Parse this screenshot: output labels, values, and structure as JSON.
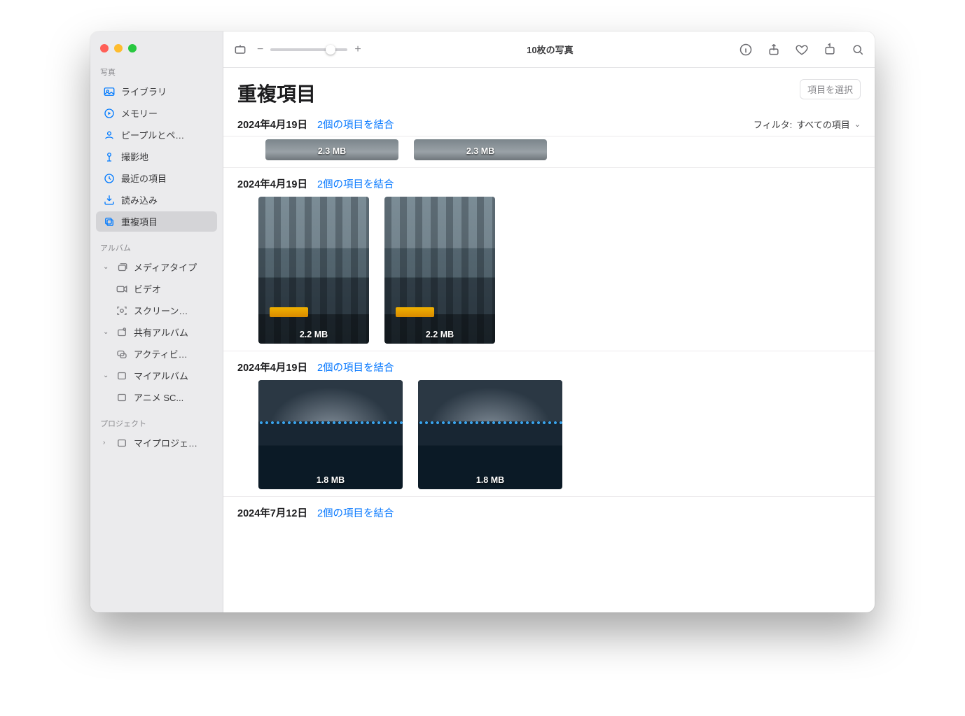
{
  "toolbar": {
    "title": "10枚の写真"
  },
  "sidebar": {
    "sections": [
      {
        "label": "写真"
      },
      {
        "label": "アルバム"
      },
      {
        "label": "プロジェクト"
      }
    ],
    "items_photos": [
      {
        "label": "ライブラリ"
      },
      {
        "label": "メモリー"
      },
      {
        "label": "ピープルとペ…"
      },
      {
        "label": "撮影地"
      },
      {
        "label": "最近の項目"
      },
      {
        "label": "読み込み"
      },
      {
        "label": "重複項目"
      }
    ],
    "albums": {
      "media_types": {
        "label": "メディアタイプ",
        "children": [
          {
            "label": "ビデオ"
          },
          {
            "label": "スクリーン…"
          }
        ]
      },
      "shared": {
        "label": "共有アルバム",
        "children": [
          {
            "label": "アクティビ…"
          }
        ]
      },
      "my": {
        "label": "マイアルバム",
        "children": [
          {
            "label": "アニメ SC..."
          }
        ]
      }
    },
    "projects": {
      "label": "マイプロジェ…"
    }
  },
  "header": {
    "title": "重複項目",
    "select_button": "項目を選択"
  },
  "sticky": {
    "date": "2024年4月19日",
    "merge": "2個の項目を結合",
    "filter_label": "フィルタ:",
    "filter_value": "すべての項目"
  },
  "groups": [
    {
      "date": "2024年4月19日",
      "merge": "2個の項目を結合",
      "cut_top": true,
      "thumb_w": 190,
      "thumb_h": 30,
      "img_class": "img-road",
      "thumbs": [
        {
          "size": "2.3 MB"
        },
        {
          "size": "2.3 MB"
        }
      ]
    },
    {
      "date": "2024年4月19日",
      "merge": "2個の項目を結合",
      "thumb_w": 158,
      "thumb_h": 210,
      "img_class": "img-city",
      "thumbs": [
        {
          "size": "2.2 MB"
        },
        {
          "size": "2.2 MB"
        }
      ]
    },
    {
      "date": "2024年4月19日",
      "merge": "2個の項目を結合",
      "thumb_w": 206,
      "thumb_h": 156,
      "img_class": "img-night",
      "thumbs": [
        {
          "size": "1.8 MB"
        },
        {
          "size": "1.8 MB"
        }
      ]
    },
    {
      "date": "2024年7月12日",
      "merge": "2個の項目を結合",
      "thumbs": []
    }
  ]
}
